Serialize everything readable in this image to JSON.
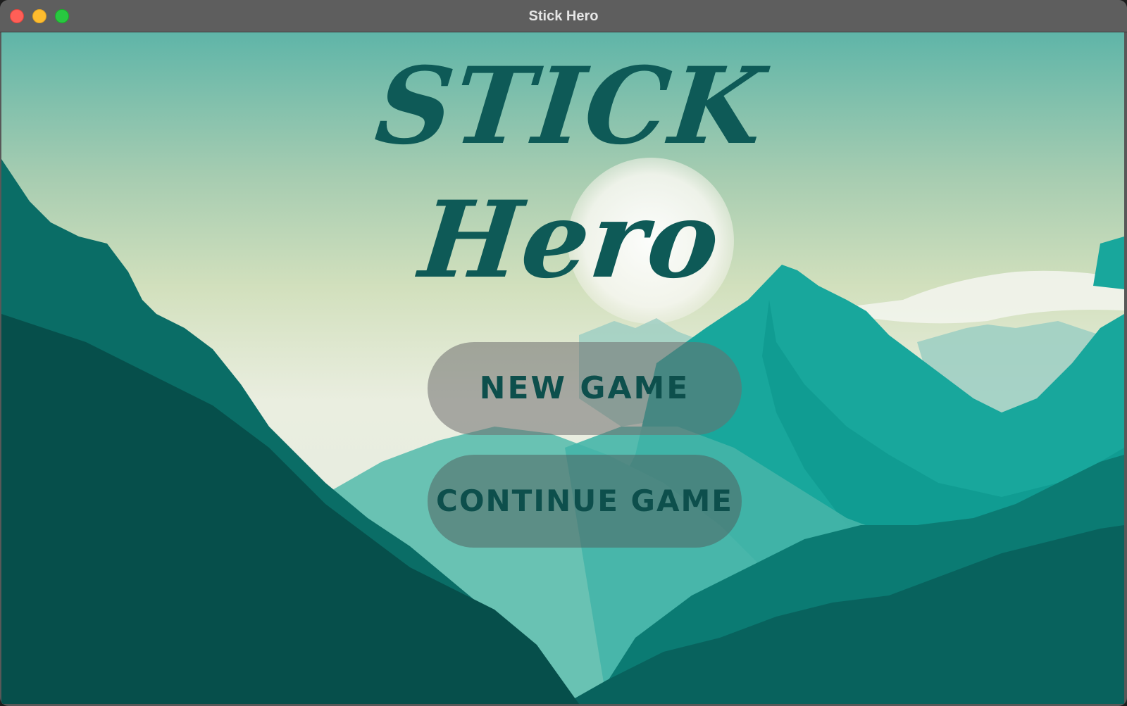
{
  "window": {
    "title": "Stick Hero",
    "controls": [
      "close",
      "minimize",
      "zoom"
    ]
  },
  "game": {
    "title_line_1": "STICK",
    "title_line_2": "Hero",
    "buttons": {
      "new_game": "NEW GAME",
      "continue_game": "CONTINUE GAME"
    }
  },
  "colors": {
    "title_text": "#0e5a57",
    "button_text": "#0d4f4c",
    "sky_top": "#5fb5a8",
    "sky_mid": "#c9dcb6",
    "sky_horizon": "#eef0e4",
    "mountain_dark": "#064f4b",
    "mountain_mid": "#0a6d66",
    "mountain_teal": "#18a79c",
    "mountain_light": "#69c2b3",
    "sun": "#f4f4ee"
  }
}
